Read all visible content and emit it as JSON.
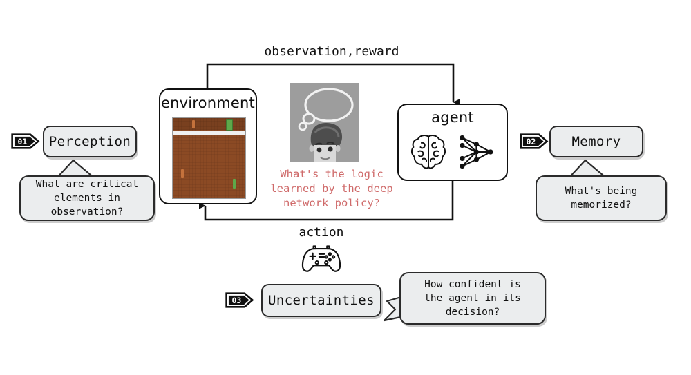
{
  "diagram": {
    "title_text_color": "#111111",
    "accent_red": "#cf6a6a",
    "bubble_fill": "#ebedee",
    "env_screen_brown": "#8b4a24",
    "env_stripe": "#f0f0f0",
    "env_green": "#5ea84a",
    "env_orange": "#c4723c"
  },
  "nodes": {
    "environment": {
      "label": "environment"
    },
    "agent": {
      "label": "agent"
    }
  },
  "edges": {
    "top": {
      "label": "observation,reward"
    },
    "bottom": {
      "label": "action"
    }
  },
  "red_note": {
    "text": "What's the logic\nlearned by the deep\nnetwork policy?"
  },
  "aspects": [
    {
      "badge": "01",
      "label": "Perception",
      "question": "What are critical\nelements in\nobservation?"
    },
    {
      "badge": "02",
      "label": "Memory",
      "question": "What's being\nmemorized?"
    },
    {
      "badge": "03",
      "label": "Uncertainties",
      "question": "How confident is\nthe agent in its\ndecision?"
    }
  ],
  "icons": {
    "brain": "brain-icon",
    "neural_net": "neural-network-icon",
    "gamepad": "gamepad-icon",
    "person_thinking": "person-thought-bubble-image"
  }
}
